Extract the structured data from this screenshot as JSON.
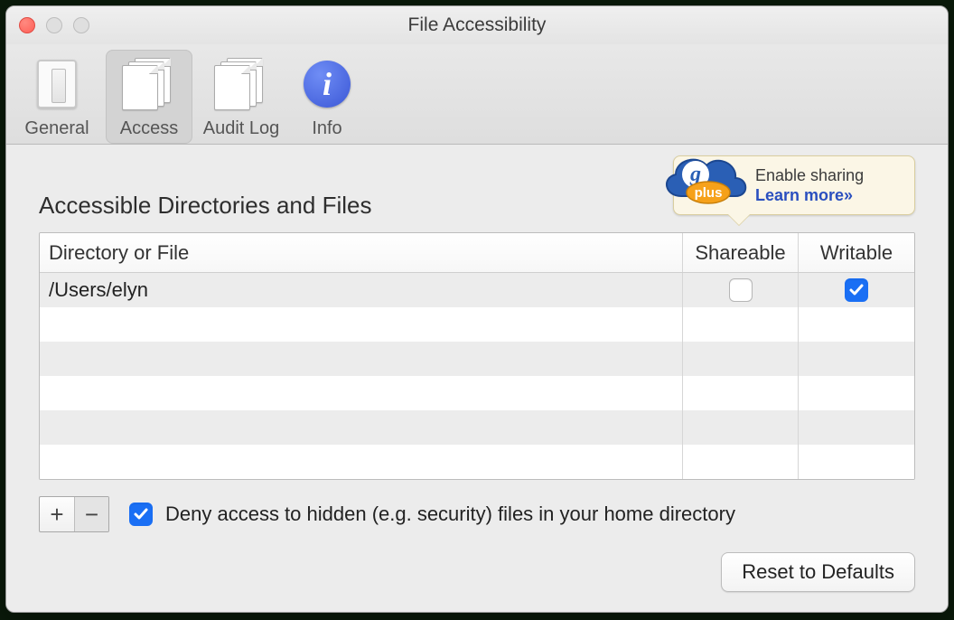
{
  "window": {
    "title": "File Accessibility"
  },
  "toolbar": {
    "items": [
      {
        "id": "general",
        "label": "General"
      },
      {
        "id": "access",
        "label": "Access"
      },
      {
        "id": "auditlog",
        "label": "Audit Log"
      },
      {
        "id": "info",
        "label": "Info"
      }
    ],
    "selected": "access"
  },
  "promo": {
    "line1": "Enable sharing",
    "line2": "Learn more»",
    "cloud_badge_text": "plus",
    "cloud_letter": "g"
  },
  "section": {
    "title": "Accessible Directories and Files"
  },
  "table": {
    "headers": {
      "path": "Directory or File",
      "shareable": "Shareable",
      "writable": "Writable"
    },
    "rows": [
      {
        "path": "/Users/elyn",
        "shareable": false,
        "writable": true
      }
    ],
    "filler_rows": 5
  },
  "controls": {
    "add_symbol": "+",
    "remove_symbol": "−",
    "deny_hidden": {
      "checked": true,
      "label": "Deny access to hidden (e.g. security) files in your home directory"
    },
    "reset_label": "Reset to Defaults"
  }
}
